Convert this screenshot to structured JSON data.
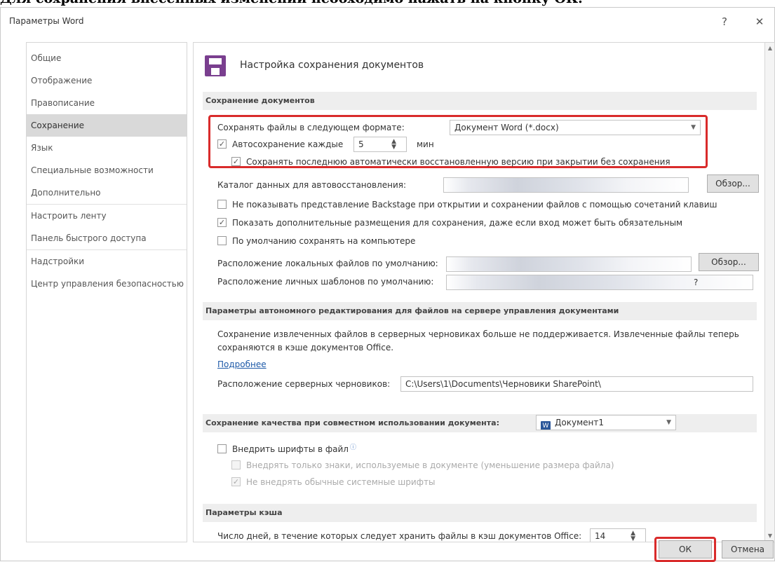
{
  "caption": "Для сохранения внесенных изменений необходимо нажать на кнопку ОК.",
  "window": {
    "title": "Параметры Word",
    "help": "?",
    "close": "✕"
  },
  "sidebar": {
    "items": [
      {
        "label": "Общие"
      },
      {
        "label": "Отображение"
      },
      {
        "label": "Правописание"
      },
      {
        "label": "Сохранение"
      },
      {
        "label": "Язык"
      },
      {
        "label": "Специальные возможности"
      },
      {
        "label": "Дополнительно"
      },
      {
        "label": "Настроить ленту"
      },
      {
        "label": "Панель быстрого доступа"
      },
      {
        "label": "Надстройки"
      },
      {
        "label": "Центр управления безопасностью"
      }
    ],
    "active": "Сохранение"
  },
  "content": {
    "page_title": "Настройка сохранения документов",
    "save_section": {
      "header": "Сохранение документов",
      "format_label": "Сохранять файлы в следующем формате:",
      "format_value": "Документ Word (*.docx)",
      "autosave_label": "Автосохранение каждые",
      "autosave_value": "5",
      "autosave_unit": "мин",
      "keep_last_label": "Сохранять последнюю автоматически восстановленную версию при закрытии без сохранения",
      "autorecover_label": "Каталог данных для автовосстановления:",
      "browse1": "Обзор...",
      "no_backstage_label": "Не показывать представление Backstage при открытии и сохранении файлов с помощью сочетаний клавиш",
      "show_additional_label": "Показать дополнительные размещения для сохранения, даже если вход может быть обязательным",
      "save_to_computer_label": "По умолчанию сохранять на компьютере",
      "local_files_label": "Расположение локальных файлов по умолчанию:",
      "browse2": "Обзор...",
      "templates_label": "Расположение личных шаблонов по умолчанию:",
      "templates_suffix": "?"
    },
    "offline_section": {
      "header": "Параметры автономного редактирования для файлов на сервере управления документами",
      "desc_line1": "Сохранение извлеченных файлов в серверных черновиках больше не поддерживается. Извлеченные файлы теперь",
      "desc_line2": "сохраняются в кэше документов Office.",
      "more_link": "Подробнее",
      "drafts_label": "Расположение серверных черновиков:",
      "drafts_value": "C:\\Users\\1\\Documents\\Черновики SharePoint\\"
    },
    "quality_section": {
      "header": "Сохранение качества при совместном использовании документа:",
      "doc_value": "Документ1",
      "embed_fonts_label": "Внедрить шрифты в файл",
      "embed_only_used_label": "Внедрять только знаки, используемые в документе (уменьшение размера файла)",
      "no_system_fonts_label": "Не внедрять обычные системные шрифты"
    },
    "cache_section": {
      "header": "Параметры кэша",
      "days_label": "Число дней, в течение которых следует хранить файлы в кэш документов Office:",
      "days_value": "14"
    }
  },
  "footer": {
    "ok": "ОК",
    "cancel": "Отмена"
  },
  "colors": {
    "highlight": "#d92b2b",
    "save_icon": "#7a3f8f",
    "link": "#1e5aa8"
  }
}
